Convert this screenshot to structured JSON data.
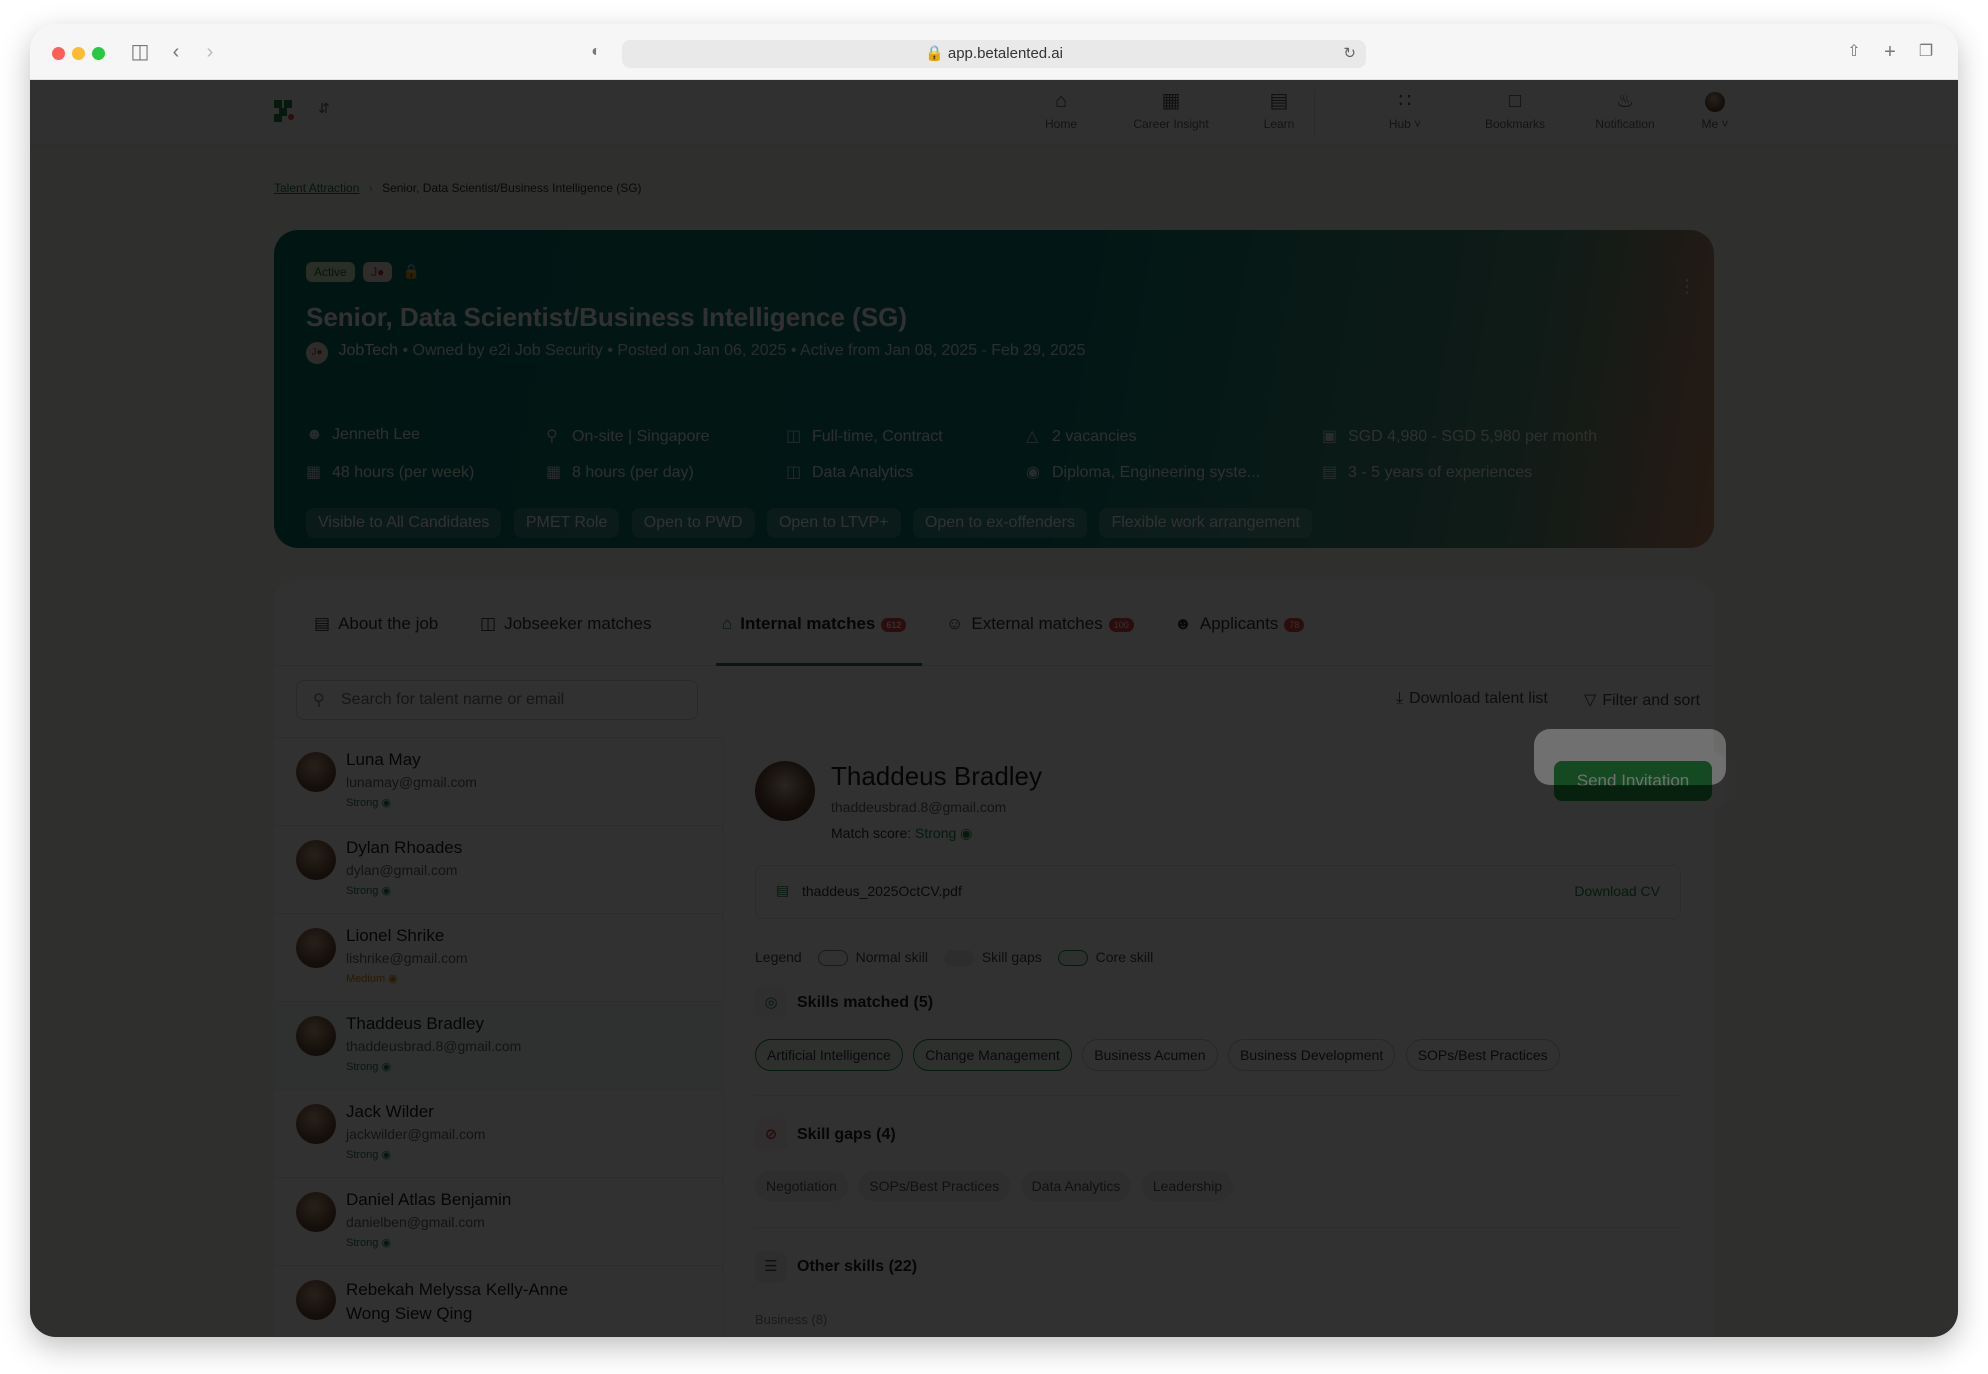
{
  "browser": {
    "url": "app.betalented.ai"
  },
  "nav": {
    "items": [
      {
        "label": "Home",
        "icon": "house-icon"
      },
      {
        "label": "Career Insight",
        "icon": "career-insight-icon"
      },
      {
        "label": "Learn",
        "icon": "book-icon"
      },
      {
        "label": "Hub",
        "icon": "grid-icon"
      },
      {
        "label": "Bookmarks",
        "icon": "bookmark-icon"
      },
      {
        "label": "Notification",
        "icon": "bell-icon"
      },
      {
        "label": "Me",
        "icon": "avatar"
      }
    ]
  },
  "breadcrumb": {
    "parent": "Talent Attraction",
    "current": "Senior, Data Scientist/Business Intelligence (SG)"
  },
  "job": {
    "status": "Active",
    "title": "Senior, Data Scientist/Business Intelligence (SG)",
    "org": "JobTech",
    "owner": "Owned by e2i Job Security",
    "posted": "Posted on Jan 06, 2025",
    "active_range": "Active from Jan 08, 2025 - Feb 29, 2025",
    "meta": {
      "recruiter": "Jenneth Lee",
      "location": "On-site | Singapore",
      "employment": "Full-time, Contract",
      "vacancies": "2 vacancies",
      "salary": "SGD 4,980 - SGD 5,980 per month",
      "hours_week": "48 hours (per week)",
      "hours_day": "8 hours (per day)",
      "function": "Data Analytics",
      "education": "Diploma, Engineering syste...",
      "experience": "3 - 5 years of experiences"
    },
    "tags": [
      "Visible to All Candidates",
      "PMET Role",
      "Open to PWD",
      "Open to LTVP+",
      "Open to ex-offenders",
      "Flexible work arrangement"
    ]
  },
  "tabs": {
    "about": "About the job",
    "jobseeker": "Jobseeker matches",
    "internal": "Internal matches",
    "internal_count": "612",
    "external": "External matches",
    "external_count": "100",
    "applicants": "Applicants",
    "applicants_count": "78"
  },
  "toolbar": {
    "search_placeholder": "Search for talent name or email",
    "download": "Download talent list",
    "filter": "Filter and sort"
  },
  "candidates": [
    {
      "name": "Luna May",
      "email": "lunamay@gmail.com",
      "status": "Strong"
    },
    {
      "name": "Dylan Rhoades",
      "email": "dylan@gmail.com",
      "status": "Strong"
    },
    {
      "name": "Lionel Shrike",
      "email": "lishrike@gmail.com",
      "status": "Medium"
    },
    {
      "name": "Thaddeus Bradley",
      "email": "thaddeusbrad.8@gmail.com",
      "status": "Strong"
    },
    {
      "name": "Jack Wilder",
      "email": "jackwilder@gmail.com",
      "status": "Strong"
    },
    {
      "name": "Daniel Atlas Benjamin",
      "email": "danielben@gmail.com",
      "status": "Strong"
    },
    {
      "name": "Rebekah Melyssa Kelly-Anne Wong Siew Qing",
      "email": "",
      "status": ""
    }
  ],
  "detail": {
    "name": "Thaddeus Bradley",
    "email": "thaddeusbrad.8@gmail.com",
    "match_label": "Match score:",
    "match_value": "Strong",
    "send_label": "Send Invitation",
    "cv_file": "thaddeus_2025OctCV.pdf",
    "cv_download": "Download CV",
    "legend_label": "Legend",
    "legend_normal": "Normal skill",
    "legend_gaps": "Skill gaps",
    "legend_core": "Core skill",
    "matched_title": "Skills matched (5)",
    "matched": [
      "Artificial Intelligence",
      "Change Management",
      "Business Acumen",
      "Business Development",
      "SOPs/Best Practices"
    ],
    "gaps_title": "Skill gaps (4)",
    "gaps": [
      "Negotiation",
      "SOPs/Best Practices",
      "Data Analytics",
      "Leadership"
    ],
    "other_title": "Other skills (22)",
    "other_sub": "Business (8)"
  },
  "colors": {
    "brand_green": "#2ea64d",
    "hero_teal": "#0a6f66",
    "count_red": "#e24545",
    "medium_orange": "#d28a10"
  }
}
